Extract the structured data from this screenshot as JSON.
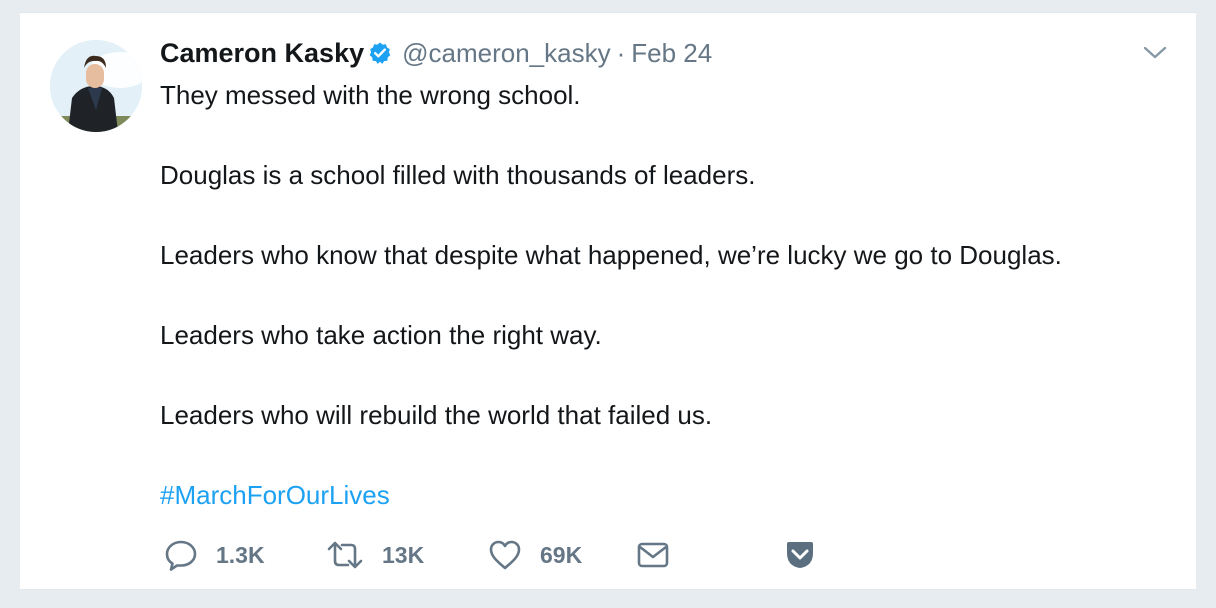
{
  "tweet": {
    "author_name": "Cameron Kasky",
    "handle": "@cameron_kasky",
    "separator": "·",
    "date": "Feb 24",
    "lines": [
      "They messed with the wrong school.",
      "Douglas is a school filled with thousands of leaders.",
      "Leaders who know that despite what happened, we’re lucky we go to Douglas.",
      "Leaders who take action the right way.",
      "Leaders who will rebuild the world that failed us."
    ],
    "hashtag": "#MarchForOurLives"
  },
  "actions": {
    "reply_count": "1.3K",
    "retweet_count": "13K",
    "like_count": "69K"
  },
  "icons": {
    "verified": "verified-badge-icon",
    "caret": "chevron-down-icon",
    "reply": "reply-icon",
    "retweet": "retweet-icon",
    "like": "heart-icon",
    "dm": "mail-icon",
    "pocket": "pocket-icon"
  },
  "colors": {
    "link_blue": "#1da1f2",
    "muted_gray": "#657786",
    "text": "#14171a",
    "page_bg": "#e6ecf0",
    "verified_blue": "#1da1f2"
  }
}
